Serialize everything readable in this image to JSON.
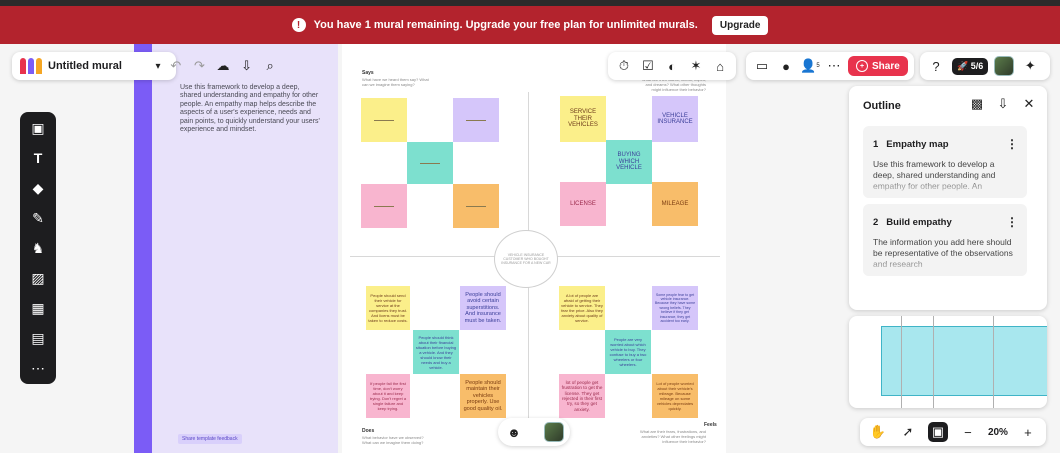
{
  "banner": {
    "message": "You have 1 mural remaining. Upgrade your free plan for unlimited murals.",
    "upgrade_label": "Upgrade",
    "color": "#b3232d"
  },
  "header": {
    "mural_title": "Untitled mural",
    "logo_colors": [
      "#e8334d",
      "#7b5cf6",
      "#f5a623"
    ]
  },
  "left_panel": {
    "framework_text": "Use this framework to develop a deep, shared understanding and empathy for other people. An empathy map helps describe the aspects of a user's experience, needs and pain points, to quickly understand your users' experience and mindset.",
    "feedback_label": "Share template feedback"
  },
  "board": {
    "says_label": "Says",
    "says_sub": "What have we heard them say? What can we imagine them saying?",
    "thinks_sub": "What are their wants, needs, hopes, and dreams? What other thoughts might influence their behavior?",
    "does_label": "Does",
    "does_sub": "What behavior have we observed? What can we imagine them doing?",
    "feels_label": "Feels",
    "feels_sub": "What are their fears, frustrations, and anxieties? What other feelings might influence their behavior?",
    "center_label": "VEHICLE INSURANCE CUSTOMER WHO BOUGHT INSURANCE FOR A NEW CAR",
    "stickies": {
      "tr1": "SERVICE THEIR VEHICLES",
      "tr2": "VEHICLE INSURANCE",
      "tr3": "BUYING WHICH VEHICLE",
      "tr4": "LICENSE",
      "tr5": "MILEAGE",
      "bl1": "People should send their vehicle for service at the companies they trust. And licens must be taken to reduce costs.",
      "bl2": "People should avoid certain superstitions. And insurance must be taken.",
      "bl3": "People should think about their financial situation before buying a vehicle. And they should know their needs and buy a vehicle.",
      "bl4": "If people fail the first time, don't worry about it and keep trying. Don't regret a single failure and keep trying.",
      "bl5": "People should maintain their vehicles properly. Use good quality oil.",
      "br1": "A lot of people are afraid of getting their vehicle to service. They fear the price. Also they anxiety about quality of service.",
      "br2": "Some people fear to get vehicle insurance. Because they have some wrong beliefs. They believe if they get insurance, they get accident too early.",
      "br3": "People are very worried about which vehicle to buy. They confuse to buy a two wheelers or four wheelers.",
      "br4": "lot of people get frustration to get the license. They get rejected in their first try, so they get anxiety.",
      "br5": "Lot of people worried about their vehicle's mileage. Because mileage on some vehicles depreciates quickly."
    }
  },
  "top_right": {
    "share_label": "Share",
    "timer_count": "5/6",
    "participants_superscript": "5"
  },
  "outline": {
    "title": "Outline",
    "items": [
      {
        "number": "1",
        "title": "Empathy map",
        "description": "Use this framework to develop a deep, shared understanding and empathy for other people. An"
      },
      {
        "number": "2",
        "title": "Build empathy",
        "description": "The information you add here should be representative of the observations and research"
      }
    ]
  },
  "zoom": {
    "level": "20%",
    "minus": "−",
    "plus": "+"
  },
  "icons": {
    "toolbar": [
      "sticky-note-icon",
      "text-icon",
      "shapes-icon",
      "pen-icon",
      "templates-icon",
      "image-icon",
      "grid-icon",
      "table-icon",
      "more-icon"
    ],
    "top_tools": [
      "timer-icon",
      "vote-icon",
      "private-mode-icon",
      "laser-icon",
      "summon-icon"
    ],
    "bottom": [
      "reaction-icon",
      "user-avatar"
    ]
  }
}
